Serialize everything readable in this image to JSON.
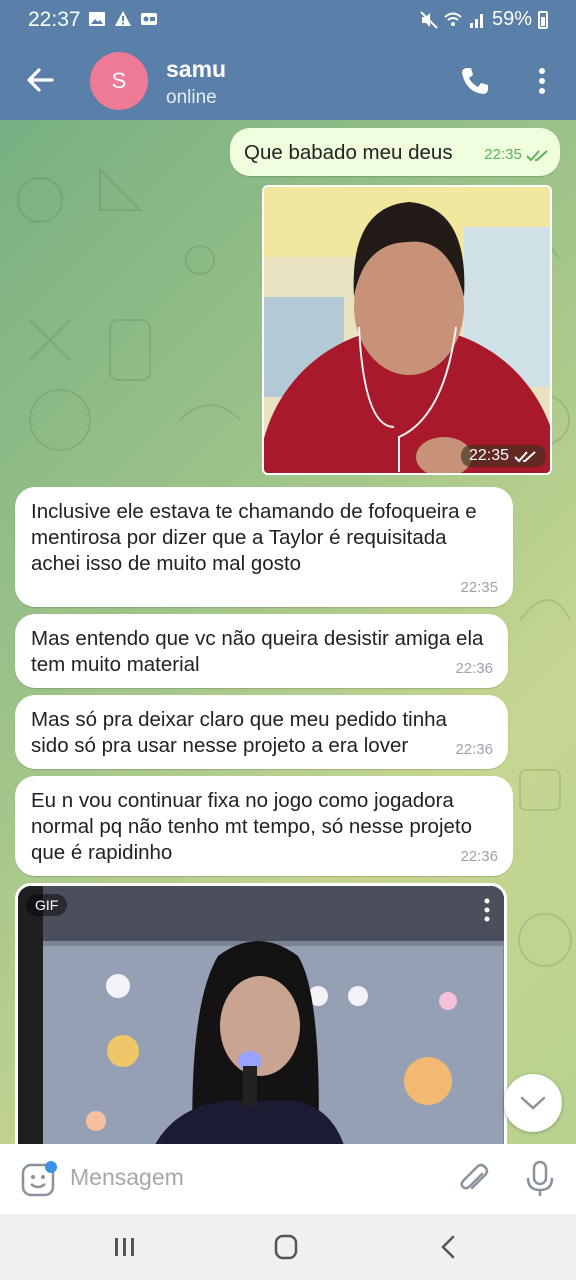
{
  "status_bar": {
    "time": "22:37",
    "battery": "59%"
  },
  "header": {
    "avatar_letter": "S",
    "contact_name": "samu",
    "contact_status": "online"
  },
  "messages": [
    {
      "id": 1,
      "direction": "outgoing",
      "text": "Que babado meu deus",
      "time": "22:35",
      "read": true
    },
    {
      "id": 2,
      "direction": "outgoing",
      "type": "photo",
      "time": "22:35",
      "read": true
    },
    {
      "id": 3,
      "direction": "incoming",
      "text": "Inclusive ele estava te chamando de fofoqueira e mentirosa por dizer que a Taylor é requisitada achei isso de muito mal gosto",
      "time": "22:35"
    },
    {
      "id": 4,
      "direction": "incoming",
      "text": "Mas entendo que vc não queira desistir amiga ela tem muito material",
      "time": "22:36"
    },
    {
      "id": 5,
      "direction": "incoming",
      "text": "Mas só pra deixar claro que meu pedido tinha sido só pra usar nesse projeto a era lover",
      "time": "22:36"
    },
    {
      "id": 6,
      "direction": "incoming",
      "text": "Eu n vou continuar fixa no jogo como jogadora normal pq não tenho mt tempo, só nesse projeto que é rapidinho",
      "time": "22:36"
    },
    {
      "id": 7,
      "direction": "incoming",
      "type": "gif",
      "tag": "GIF"
    }
  ],
  "input": {
    "placeholder": "Mensagem"
  },
  "colors": {
    "header": "#5a7fa8",
    "avatar": "#ee7a95",
    "outgoing_bubble": "#effedd",
    "incoming_bubble": "#ffffff",
    "check": "#5fae5a"
  },
  "icons": [
    "back-arrow-icon",
    "phone-icon",
    "more-vertical-icon",
    "emoji-sticker-icon",
    "paperclip-icon",
    "microphone-icon",
    "chevron-down-icon",
    "double-check-icon"
  ]
}
